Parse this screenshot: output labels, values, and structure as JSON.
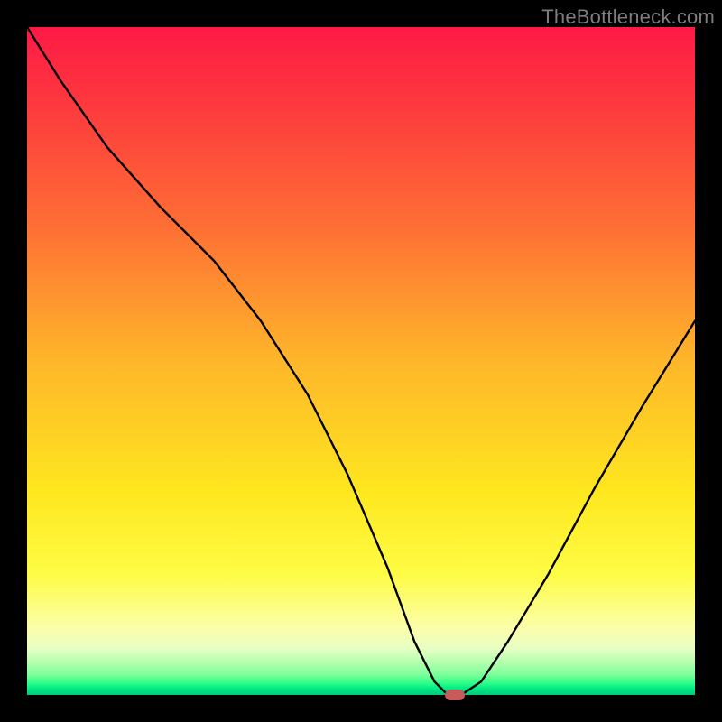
{
  "watermark": "TheBottleneck.com",
  "chart_data": {
    "type": "line",
    "title": "",
    "xlabel": "",
    "ylabel": "",
    "xlim": [
      0,
      100
    ],
    "ylim": [
      0,
      100
    ],
    "grid": false,
    "legend": false,
    "x": [
      0,
      5,
      12,
      20,
      28,
      35,
      42,
      48,
      54,
      58,
      61,
      63,
      65,
      68,
      72,
      78,
      85,
      92,
      100
    ],
    "values": [
      100,
      92,
      82,
      73,
      65,
      56,
      45,
      33,
      19,
      8,
      2,
      0,
      0,
      2,
      8,
      18,
      31,
      43,
      56
    ],
    "marker": {
      "x": 64,
      "y": 0
    },
    "background_gradient": {
      "top": "#fd1a45",
      "mid": "#fee81f",
      "bottom": "#00c97a"
    }
  }
}
